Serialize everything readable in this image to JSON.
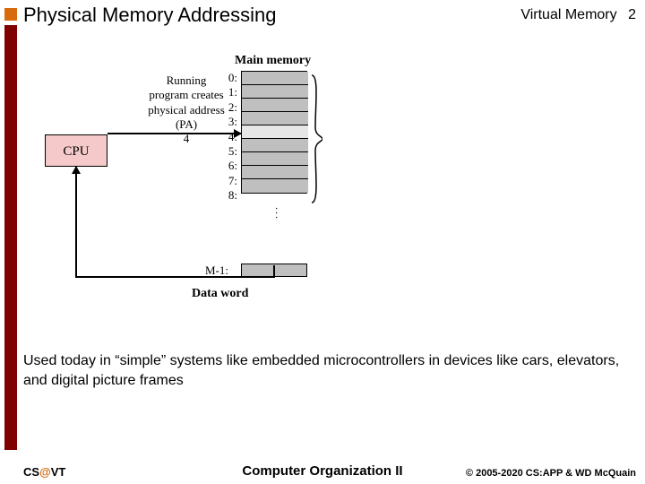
{
  "header": {
    "title": "Physical Memory Addressing",
    "right_label": "Virtual Memory",
    "page_number": "2"
  },
  "diagram": {
    "main_memory_label": "Main memory",
    "cpu_label": "CPU",
    "running_text_lines": [
      "Running",
      "program creates",
      "physical address",
      "(PA)",
      "4"
    ],
    "cell_labels": [
      "0:",
      "1:",
      "2:",
      "3:",
      "4:",
      "5:",
      "6:",
      "7:",
      "8:"
    ],
    "last_cell_label": "M-1:",
    "selected_index": 4,
    "dots": "...",
    "data_word_label": "Data word"
  },
  "body": {
    "text": "Used today in “simple” systems like embedded microcontrollers in devices like cars, elevators, and digital picture frames"
  },
  "footer": {
    "left_prefix": "CS",
    "left_at": "@",
    "left_suffix": "VT",
    "center": "Computer Organization II",
    "right": "© 2005-2020 CS:APP & WD McQuain"
  }
}
